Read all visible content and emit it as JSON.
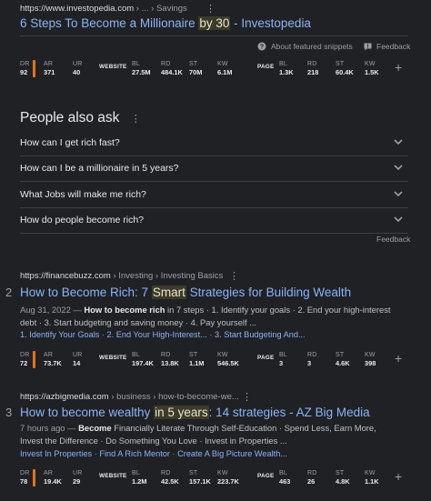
{
  "result1": {
    "url": "https://www.investopedia.com",
    "url_path": " › ... › Savings",
    "title_pre": "6 Steps To Become a Millionaire ",
    "title_hl": "by 30",
    "title_post": " - Investopedia",
    "about_snippets": "About featured snippets",
    "feedback": "Feedback",
    "metrics": {
      "dr": {
        "k": "DR",
        "v": "92"
      },
      "ar": {
        "k": "AR",
        "v": "371"
      },
      "ur": {
        "k": "UR",
        "v": "40"
      },
      "website": "WEBSITE",
      "bl": {
        "k": "BL",
        "v": "27.5M"
      },
      "rd": {
        "k": "RD",
        "v": "484.1K"
      },
      "st": {
        "k": "ST",
        "v": "70M"
      },
      "kw": {
        "k": "KW",
        "v": "6.1M"
      },
      "page": "PAGE",
      "pbl": {
        "k": "BL",
        "v": "1.3K"
      },
      "prd": {
        "k": "RD",
        "v": "218"
      },
      "pst": {
        "k": "ST",
        "v": "60.4K"
      },
      "pkw": {
        "k": "KW",
        "v": "1.5K"
      }
    }
  },
  "paa": {
    "heading": "People also ask",
    "questions": [
      "How can I get rich fast?",
      "How can I be a millionaire in 5 years?",
      "What Jobs will make me rich?",
      "How do people become rich?"
    ],
    "feedback": "Feedback"
  },
  "result2": {
    "rank": "2",
    "url": "https://financebuzz.com",
    "url_path": " › Investing › Investing Basics",
    "title_pre": "How to Become Rich: 7 ",
    "title_hl": "Smart",
    "title_post": " Strategies for Building Wealth",
    "date": "Aug 31, 2022",
    "snippet1_bold": "How to become rich",
    "snippet1_rest": " in 7 steps · 1. Identify your goals · 2. End your high-interest",
    "snippet2": "debt · 3. Start budgeting and saving money · 4. Pay yourself ...",
    "sitelinks": [
      "1. Identify Your Goals",
      "2. End Your High-Interest...",
      "3. Start Budgeting And..."
    ],
    "metrics": {
      "dr": {
        "k": "DR",
        "v": "72"
      },
      "ar": {
        "k": "AR",
        "v": "73.7K"
      },
      "ur": {
        "k": "UR",
        "v": "14"
      },
      "website": "WEBSITE",
      "bl": {
        "k": "BL",
        "v": "197.4K"
      },
      "rd": {
        "k": "RD",
        "v": "13.8K"
      },
      "st": {
        "k": "ST",
        "v": "1.1M"
      },
      "kw": {
        "k": "KW",
        "v": "546.5K"
      },
      "page": "PAGE",
      "pbl": {
        "k": "BL",
        "v": "3"
      },
      "prd": {
        "k": "RD",
        "v": "3"
      },
      "pst": {
        "k": "ST",
        "v": "4.6K"
      },
      "pkw": {
        "k": "KW",
        "v": "398"
      }
    }
  },
  "result3": {
    "rank": "3",
    "url": "https://azbigmedia.com",
    "url_path": " › business › how-to-become-we...",
    "title_pre": "How to become wealthy ",
    "title_hl": "in 5 years",
    "title_post": ": 14 strategies - AZ Big Media",
    "date": "7 hours ago",
    "snippet1_bold": "Become",
    "snippet1_rest": " Financially Literate Through Self-Education · Spend Less, Earn More,",
    "snippet2": "Invest the Difference · Do Something You Love · Invest in Properties ...",
    "sitelinks": [
      "Invest In Properties",
      "Find A Rich Mentor",
      "Create A Big Picture Wealth..."
    ],
    "metrics": {
      "dr": {
        "k": "DR",
        "v": "78"
      },
      "ar": {
        "k": "AR",
        "v": "19.4K"
      },
      "ur": {
        "k": "UR",
        "v": "29"
      },
      "website": "WEBSITE",
      "bl": {
        "k": "BL",
        "v": "1.2M"
      },
      "rd": {
        "k": "RD",
        "v": "42.5K"
      },
      "st": {
        "k": "ST",
        "v": "157.1K"
      },
      "kw": {
        "k": "KW",
        "v": "223.7K"
      },
      "page": "PAGE",
      "pbl": {
        "k": "BL",
        "v": "463"
      },
      "prd": {
        "k": "RD",
        "v": "26"
      },
      "pst": {
        "k": "ST",
        "v": "4.8K"
      },
      "pkw": {
        "k": "KW",
        "v": "1.1K"
      }
    }
  },
  "colors": {
    "background": "#202124",
    "link": "#8ab4f8",
    "highlight": "#3c3a2a",
    "accent_bar": "#e8711a"
  }
}
